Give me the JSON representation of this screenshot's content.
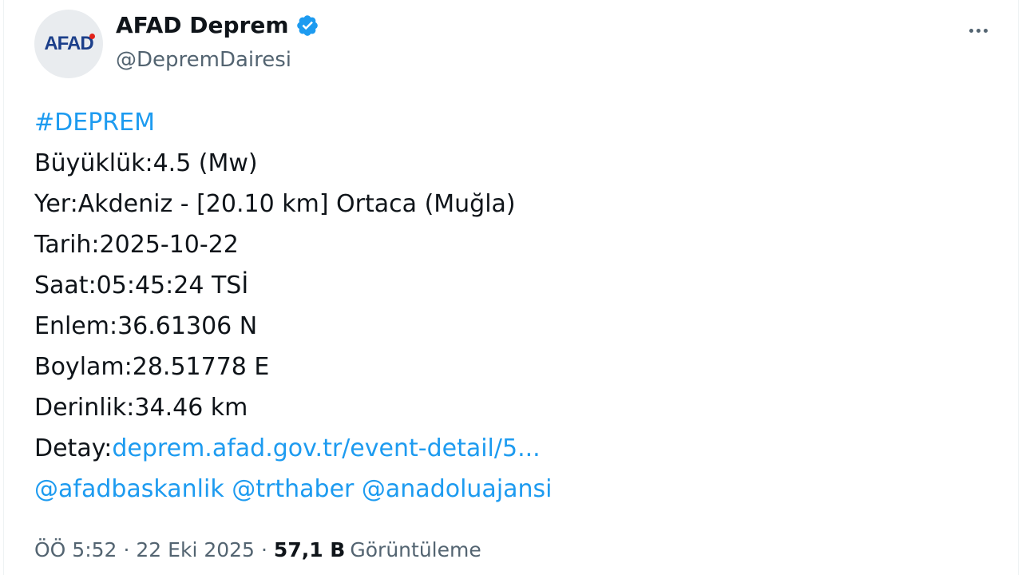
{
  "author": {
    "avatar_text": "AFAD",
    "display_name": "AFAD Deprem",
    "handle": "@DepremDairesi",
    "verified": true
  },
  "tweet": {
    "hashtag": "#DEPREM",
    "lines": [
      "Büyüklük:4.5 (Mw)",
      "Yer:Akdeniz - [20.10 km] Ortaca (Muğla)",
      "Tarih:2025-10-22",
      "Saat:05:45:24 TSİ",
      "Enlem:36.61306 N",
      "Boylam:28.51778 E",
      "Derinlik:34.46 km"
    ],
    "detail_label": "Detay:",
    "detail_link": "deprem.afad.gov.tr/event-detail/5...",
    "mentions": [
      "@afadbaskanlik",
      "@trthaber",
      "@anadoluajansi"
    ]
  },
  "meta": {
    "time": "ÖÖ 5:52",
    "separator": "·",
    "date": "22 Eki 2025",
    "views_count": "57,1 B",
    "views_label": "Görüntüleme"
  },
  "colors": {
    "link": "#1d9bf0",
    "secondary_text": "#536471",
    "verified_badge": "#1d9bf0"
  },
  "icons": {
    "verified": "verified-badge-icon",
    "more": "more-options-icon"
  }
}
